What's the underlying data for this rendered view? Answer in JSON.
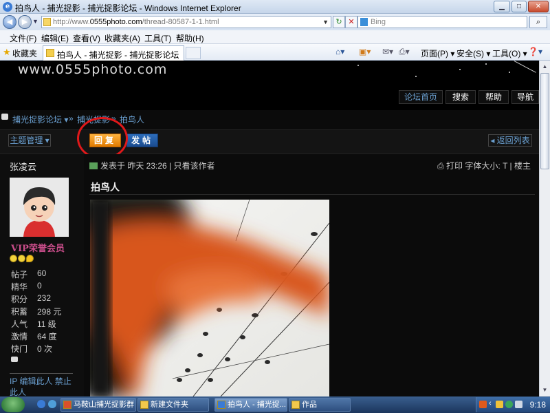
{
  "window": {
    "title": "拍鸟人 - 捕光捉影 - 捕光捉影论坛 - Windows Internet Explorer",
    "controls": [
      "0",
      "1",
      "r"
    ]
  },
  "address_bar": {
    "url_prefix": "http://www.",
    "url_domain": "0555photo.com",
    "url_suffix": "/thread-80587-1-1.html",
    "search_placeholder": "Bing"
  },
  "menu": [
    "文件(F)",
    "编辑(E)",
    "查看(V)",
    "收藏夹(A)",
    "工具(T)",
    "帮助(H)"
  ],
  "favorites_bar": {
    "label": "收藏夹",
    "tab_title": "拍鸟人 - 捕光捉影 - 捕光捉影论坛",
    "commands": [
      "页面(P)",
      "安全(S)",
      "工具(O)"
    ]
  },
  "site": {
    "name": "www.0555photo.com",
    "nav": [
      "论坛首页",
      "搜索",
      "帮助",
      "导航"
    ]
  },
  "breadcrumb": [
    "捕光捉影论坛",
    "»",
    "捕光捉影",
    "»",
    "拍鸟人"
  ],
  "toolbar": {
    "manage": "主题管理",
    "reply": "回复",
    "post": "发帖",
    "back": "返回列表"
  },
  "author": {
    "name": "张凌云",
    "group": "VIP荣誉会员",
    "stats": [
      {
        "label": "帖子",
        "value": "60"
      },
      {
        "label": "精华",
        "value": "0"
      },
      {
        "label": "积分",
        "value": "232"
      },
      {
        "label": "积蓄",
        "value": "298 元"
      },
      {
        "label": "人气",
        "value": "11 级"
      },
      {
        "label": "激情",
        "value": "64 度"
      },
      {
        "label": "快门",
        "value": "0 次"
      }
    ],
    "links": "IP  编辑此人  禁止此人"
  },
  "post": {
    "meta": "发表于 昨天 23:26  |  只看该作者",
    "print": "打印",
    "font_size": "字体大小:",
    "font_t": "T",
    "floor": "楼主",
    "title": "拍鸟人"
  },
  "taskbar": {
    "items": [
      "马鞍山捕光捉影群",
      "新建文件夹",
      "拍鸟人 - 捕光捉...",
      "作品"
    ],
    "clock": "9:18"
  },
  "colors": {
    "link": "#6a9fd0",
    "reply_button": "#f59a1a",
    "post_button": "#1f5aa6",
    "highlight_circle": "#e0181a",
    "vip": "#c94d8a"
  }
}
